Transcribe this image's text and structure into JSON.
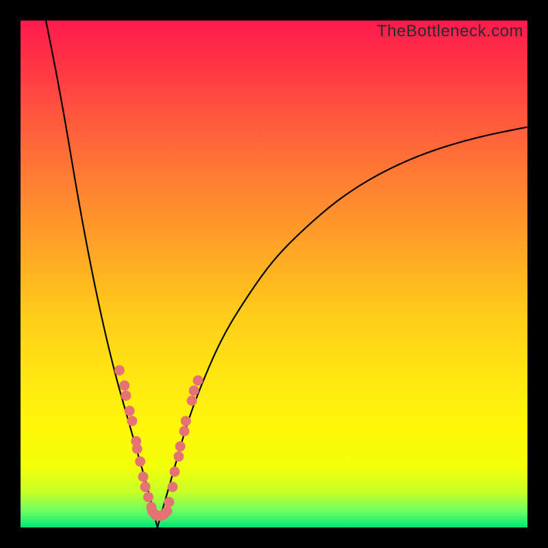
{
  "watermark": "TheBottleneck.com",
  "colors": {
    "frame_border": "#000000",
    "curve": "#000000",
    "dot": "#e57373",
    "gradient_top": "#ff1a4d",
    "gradient_bottom": "#00e676"
  },
  "chart_data": {
    "type": "line",
    "title": "",
    "xlabel": "",
    "ylabel": "",
    "xlim": [
      0,
      100
    ],
    "ylim": [
      0,
      100
    ],
    "notch_x": 27,
    "curve_left": {
      "x": [
        5,
        7,
        9,
        11,
        13,
        15,
        17,
        19,
        21,
        23,
        25,
        27
      ],
      "y": [
        100,
        90,
        79,
        67,
        56,
        46,
        37,
        29,
        22,
        15,
        8,
        0
      ]
    },
    "curve_right": {
      "x": [
        27,
        29,
        31,
        33,
        36,
        40,
        45,
        50,
        56,
        63,
        71,
        80,
        90,
        100
      ],
      "y": [
        0,
        7,
        14,
        21,
        29,
        38,
        46,
        53,
        59,
        65,
        70,
        74,
        77,
        79
      ]
    },
    "dots": [
      {
        "x": 19.5,
        "y": 31
      },
      {
        "x": 20.5,
        "y": 28
      },
      {
        "x": 20.8,
        "y": 26
      },
      {
        "x": 21.5,
        "y": 23
      },
      {
        "x": 22.0,
        "y": 21
      },
      {
        "x": 22.8,
        "y": 17
      },
      {
        "x": 23.0,
        "y": 15.5
      },
      {
        "x": 23.6,
        "y": 13
      },
      {
        "x": 24.2,
        "y": 10
      },
      {
        "x": 24.6,
        "y": 8
      },
      {
        "x": 25.2,
        "y": 6
      },
      {
        "x": 25.8,
        "y": 4
      },
      {
        "x": 26.0,
        "y": 3.2
      },
      {
        "x": 26.6,
        "y": 2.5
      },
      {
        "x": 27.0,
        "y": 2.3
      },
      {
        "x": 27.6,
        "y": 2.3
      },
      {
        "x": 28.2,
        "y": 2.5
      },
      {
        "x": 28.9,
        "y": 3.2
      },
      {
        "x": 29.3,
        "y": 5
      },
      {
        "x": 30.0,
        "y": 8
      },
      {
        "x": 30.4,
        "y": 11
      },
      {
        "x": 31.2,
        "y": 14
      },
      {
        "x": 31.5,
        "y": 16
      },
      {
        "x": 32.3,
        "y": 19
      },
      {
        "x": 32.6,
        "y": 21
      },
      {
        "x": 33.8,
        "y": 25
      },
      {
        "x": 34.2,
        "y": 27
      },
      {
        "x": 35.0,
        "y": 29
      }
    ]
  }
}
